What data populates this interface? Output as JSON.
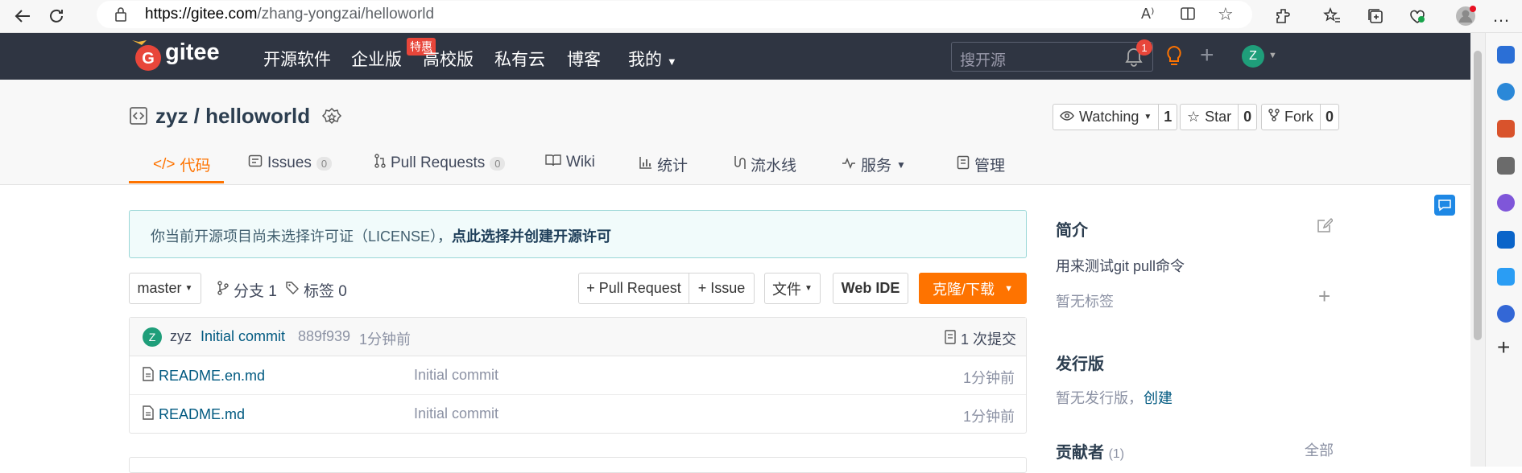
{
  "browser": {
    "url_host": "https://gitee.com",
    "url_path": "/zhang-yongzai/helloworld"
  },
  "header": {
    "logo_text": "gitee",
    "nav": [
      "开源软件",
      "企业版",
      "高校版",
      "私有云",
      "博客",
      "我的"
    ],
    "hot_badge": "特惠",
    "search_placeholder": "搜开源",
    "notification_count": "1",
    "user_initial": "Z"
  },
  "project": {
    "title": "zyz / helloworld",
    "watch_label": "Watching",
    "watch_count": "1",
    "star_label": "Star",
    "star_count": "0",
    "fork_label": "Fork",
    "fork_count": "0",
    "tabs": {
      "code": "代码",
      "issues": "Issues",
      "issues_count": "0",
      "pr": "Pull Requests",
      "pr_count": "0",
      "wiki": "Wiki",
      "stats": "统计",
      "pipeline": "流水线",
      "service": "服务",
      "manage": "管理"
    }
  },
  "license": {
    "text": "你当前开源项目尚未选择许可证（LICENSE），",
    "link": "点此选择并创建开源许可"
  },
  "toolbar": {
    "branch": "master",
    "branches": "分支 1",
    "tags": "标签 0",
    "pull_request": "+ Pull Request",
    "issue": "+ Issue",
    "file": "文件",
    "web_ide": "Web IDE",
    "clone": "克隆/下载"
  },
  "commit": {
    "user_initial": "Z",
    "author": "zyz",
    "message": "Initial commit",
    "hash": "889f939",
    "time": "1分钟前",
    "total": "1 次提交"
  },
  "files": [
    {
      "name": "README.en.md",
      "message": "Initial commit",
      "time": "1分钟前"
    },
    {
      "name": "README.md",
      "message": "Initial commit",
      "time": "1分钟前"
    }
  ],
  "sidebar": {
    "intro_title": "简介",
    "intro_text": "用来测试git pull命令",
    "no_tags": "暂无标签",
    "release_title": "发行版",
    "no_release": "暂无发行版，",
    "create": "创建",
    "contrib_title": "贡献者",
    "contrib_count": "(1)",
    "all": "全部"
  },
  "colors": {
    "accent": "#fe7300",
    "header_bg": "#2f3542",
    "link": "#005980"
  }
}
